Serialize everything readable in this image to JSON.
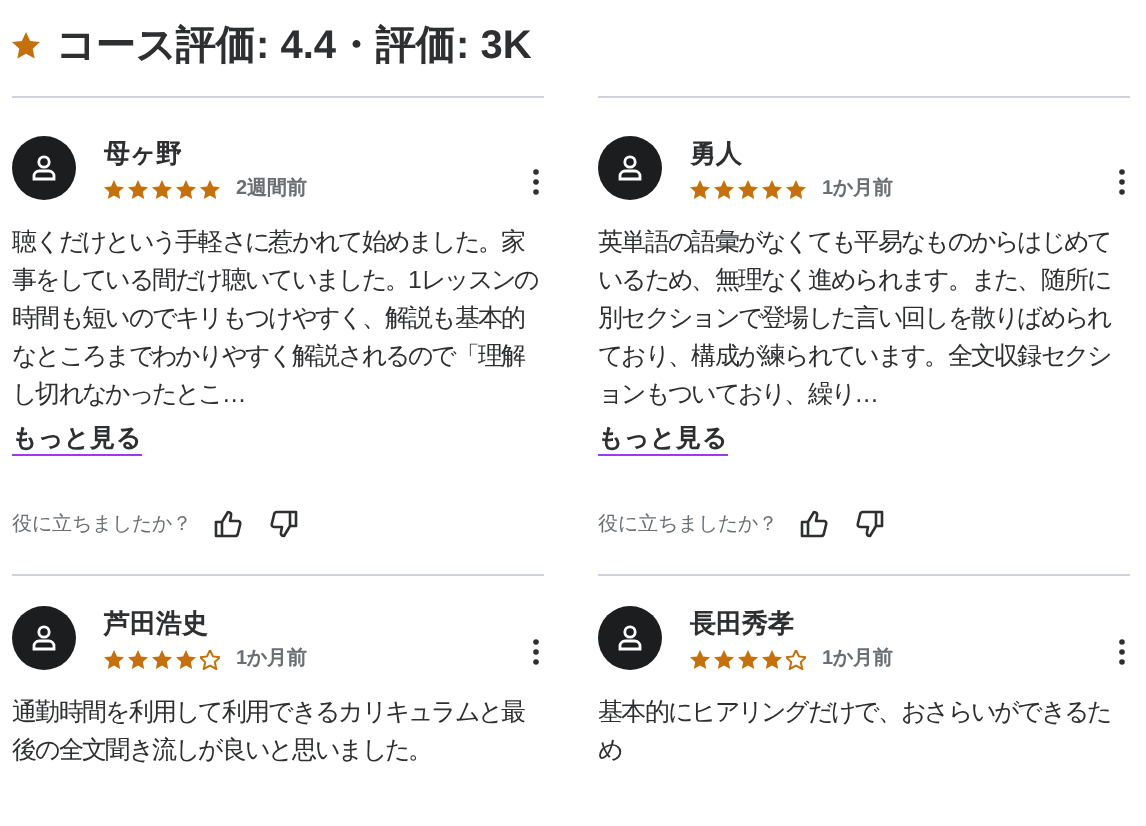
{
  "header": {
    "title": "コース評価: 4.4・評価: 3K"
  },
  "reviews": [
    {
      "name": "母ヶ野",
      "stars": 5,
      "time": "2週間前",
      "text": "聴くだけという手軽さに惹かれて始めました。家事をしている間だけ聴いていました。1レッスンの時間も短いのでキリもつけやすく、解説も基本的なところまでわかりやすく解説されるので「理解し切れなかったとこ…",
      "more": "もっと見る",
      "helpful": "役に立ちましたか？"
    },
    {
      "name": "勇人",
      "stars": 5,
      "time": "1か月前",
      "text": "英単語の語彙がなくても平易なものからはじめているため、無理なく進められます。また、随所に別セクションで登場した言い回しを散りばめられており、構成が練られています。全文収録セクションもついており、繰り…",
      "more": "もっと見る",
      "helpful": "役に立ちましたか？"
    },
    {
      "name": "芦田浩史",
      "stars": 4,
      "time": "1か月前",
      "text": "通勤時間を利用して利用できるカリキュラムと最後の全文聞き流しが良いと思いました。"
    },
    {
      "name": "長田秀孝",
      "stars": 4,
      "time": "1か月前",
      "text": "基本的にヒアリングだけで、おさらいができるため"
    }
  ]
}
